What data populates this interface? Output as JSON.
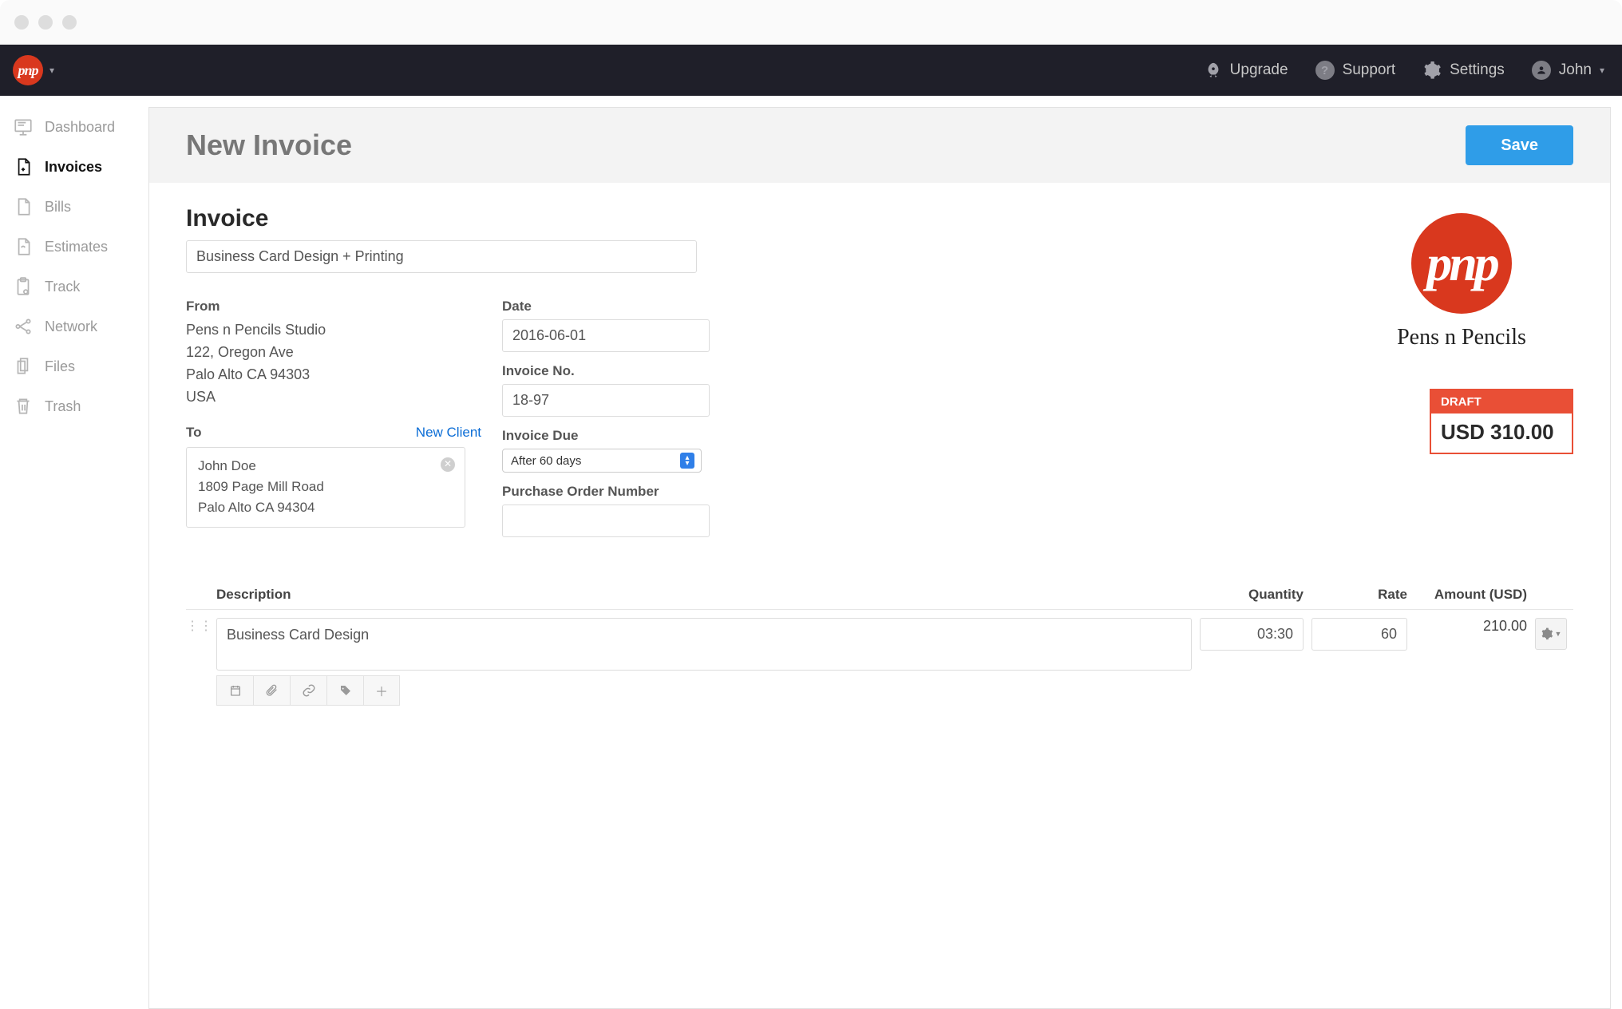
{
  "header": {
    "upgrade": "Upgrade",
    "support": "Support",
    "settings": "Settings",
    "user": "John"
  },
  "sidebar": {
    "items": [
      {
        "label": "Dashboard"
      },
      {
        "label": "Invoices"
      },
      {
        "label": "Bills"
      },
      {
        "label": "Estimates"
      },
      {
        "label": "Track"
      },
      {
        "label": "Network"
      },
      {
        "label": "Files"
      },
      {
        "label": "Trash"
      }
    ]
  },
  "page": {
    "title": "New Invoice",
    "save": "Save"
  },
  "invoice": {
    "section_heading": "Invoice",
    "subject_value": "Business Card Design + Printing",
    "from_label": "From",
    "from_lines": [
      "Pens n Pencils Studio",
      "122, Oregon Ave",
      "Palo Alto CA 94303",
      "USA"
    ],
    "to_label": "To",
    "new_client": "New Client",
    "to_lines": [
      "John Doe",
      "1809 Page Mill Road",
      "Palo Alto CA 94304"
    ],
    "date_label": "Date",
    "date_value": "2016-06-01",
    "num_label": "Invoice No.",
    "num_value": "18-97",
    "due_label": "Invoice Due",
    "due_value": "After 60 days",
    "po_label": "Purchase Order Number",
    "po_value": ""
  },
  "brand": {
    "company": "Pens n Pencils",
    "badge_text": "pnp",
    "status": "DRAFT",
    "total": "USD 310.00"
  },
  "columns": {
    "desc": "Description",
    "qty": "Quantity",
    "rate": "Rate",
    "amount": "Amount (USD)"
  },
  "lines": [
    {
      "desc": "Business Card Design",
      "qty": "03:30",
      "rate": "60",
      "amount": "210.00"
    }
  ]
}
